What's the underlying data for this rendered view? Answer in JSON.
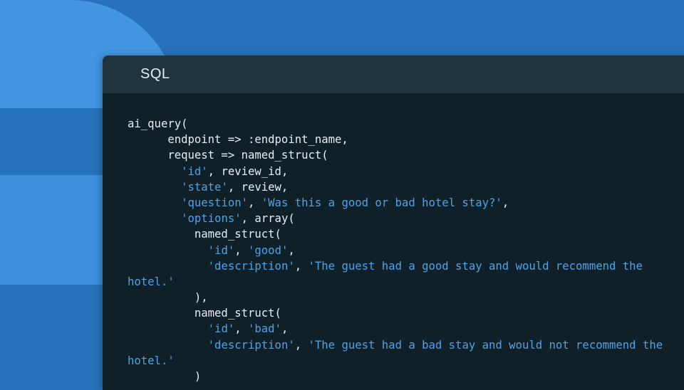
{
  "window": {
    "language": "SQL"
  },
  "code": {
    "lines": [
      [
        {
          "t": "ai_query(",
          "k": "plain"
        }
      ],
      [
        {
          "t": "      endpoint => :endpoint_name,",
          "k": "plain"
        }
      ],
      [
        {
          "t": "      request => named_struct(",
          "k": "plain"
        }
      ],
      [
        {
          "t": "        ",
          "k": "plain"
        },
        {
          "t": "'id'",
          "k": "string"
        },
        {
          "t": ", review_id,",
          "k": "plain"
        }
      ],
      [
        {
          "t": "        ",
          "k": "plain"
        },
        {
          "t": "'state'",
          "k": "string"
        },
        {
          "t": ", review,",
          "k": "plain"
        }
      ],
      [
        {
          "t": "        ",
          "k": "plain"
        },
        {
          "t": "'question'",
          "k": "string"
        },
        {
          "t": ", ",
          "k": "plain"
        },
        {
          "t": "'Was this a good or bad hotel stay?'",
          "k": "string"
        },
        {
          "t": ",",
          "k": "plain"
        }
      ],
      [
        {
          "t": "        ",
          "k": "plain"
        },
        {
          "t": "'options'",
          "k": "string"
        },
        {
          "t": ", array(",
          "k": "plain"
        }
      ],
      [
        {
          "t": "          named_struct(",
          "k": "plain"
        }
      ],
      [
        {
          "t": "            ",
          "k": "plain"
        },
        {
          "t": "'id'",
          "k": "string"
        },
        {
          "t": ", ",
          "k": "plain"
        },
        {
          "t": "'good'",
          "k": "string"
        },
        {
          "t": ",",
          "k": "plain"
        }
      ],
      [
        {
          "t": "            ",
          "k": "plain"
        },
        {
          "t": "'description'",
          "k": "string"
        },
        {
          "t": ", ",
          "k": "plain"
        },
        {
          "t": "'The guest had a good stay and would recommend the",
          "k": "string"
        }
      ],
      [
        {
          "t": "hotel.'",
          "k": "string"
        }
      ],
      [
        {
          "t": "          ),",
          "k": "plain"
        }
      ],
      [
        {
          "t": "          named_struct(",
          "k": "plain"
        }
      ],
      [
        {
          "t": "            ",
          "k": "plain"
        },
        {
          "t": "'id'",
          "k": "string"
        },
        {
          "t": ", ",
          "k": "plain"
        },
        {
          "t": "'bad'",
          "k": "string"
        },
        {
          "t": ",",
          "k": "plain"
        }
      ],
      [
        {
          "t": "            ",
          "k": "plain"
        },
        {
          "t": "'description'",
          "k": "string"
        },
        {
          "t": ", ",
          "k": "plain"
        },
        {
          "t": "'The guest had a bad stay and would not recommend the",
          "k": "string"
        }
      ],
      [
        {
          "t": "hotel.'",
          "k": "string"
        }
      ],
      [
        {
          "t": "          )",
          "k": "plain"
        }
      ]
    ]
  },
  "colors": {
    "background": "#2772ba",
    "background_shape_light": "#4296e2",
    "editor_background": "#0f2029",
    "header_background": "#1f343d",
    "code_text": "#e6eef2",
    "string_literal": "#4ea3e6"
  }
}
